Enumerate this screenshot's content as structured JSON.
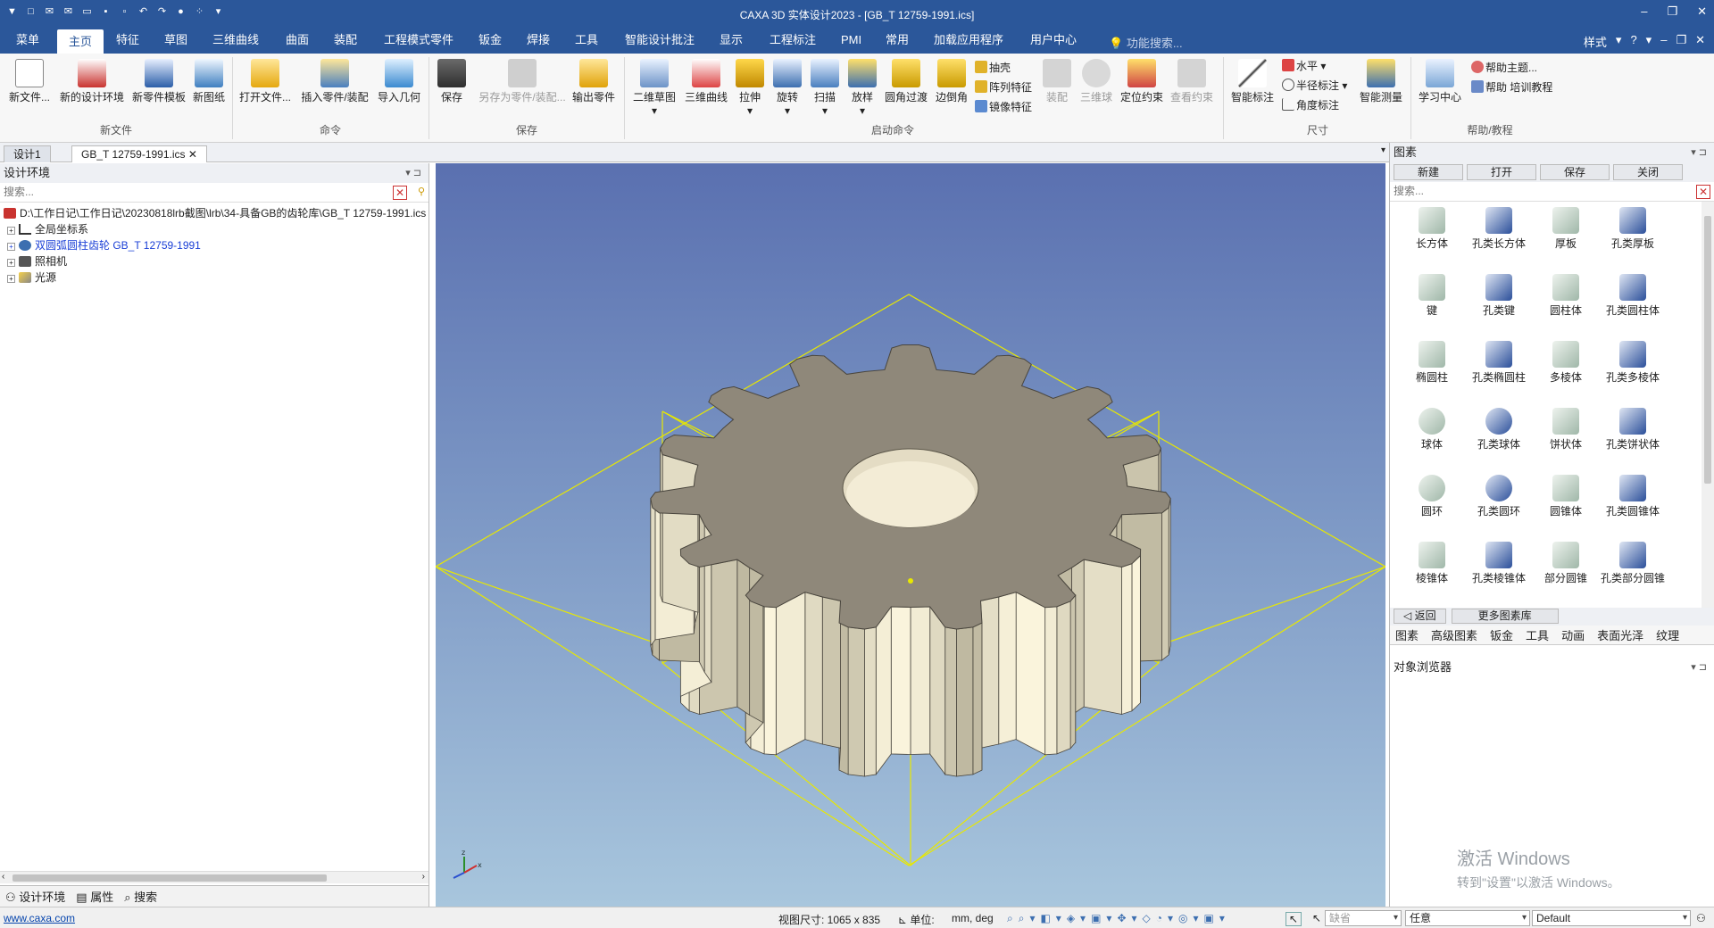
{
  "window": {
    "title": "CAXA 3D 实体设计2023 - [GB_T 12759-1991.ics]"
  },
  "menu": {
    "items": [
      "菜单",
      "主页",
      "特征",
      "草图",
      "三维曲线",
      "曲面",
      "装配",
      "工程模式零件",
      "钣金",
      "焊接",
      "工具",
      "智能设计批注",
      "显示",
      "工程标注",
      "PMI",
      "常用",
      "加载应用程序",
      "用户中心"
    ],
    "search_hint": "功能搜索...",
    "style_label": "样式"
  },
  "ribbon": {
    "new_file": "新文件...",
    "new_env": "新的设计环境",
    "new_template": "新零件模板",
    "new_drawing": "新图纸",
    "open_file": "打开文件...",
    "insert_part": "插入零件/装配",
    "import_geom": "导入几何",
    "save": "保存",
    "save_as": "另存为零件/装配...",
    "export_part": "输出零件",
    "sketch2d": "二维草图",
    "curve3d": "三维曲线",
    "extrude": "拉伸",
    "revolve": "旋转",
    "sweep": "扫描",
    "loft": "放样",
    "fillet": "圆角过渡",
    "chamfer": "边倒角",
    "shell": "抽壳",
    "pattern": "阵列特征",
    "mirror": "镜像特征",
    "assembly": "装配",
    "ball3d": "三维球",
    "constraint": "定位约束",
    "view_constraint": "查看约束",
    "smart_dim": "智能标注",
    "horizontal": "水平",
    "radius_dim": "半径标注",
    "angle_dim": "角度标注",
    "smart_measure": "智能测量",
    "learn_center": "学习中心",
    "help_topic": "帮助主题...",
    "help_training": "帮助 培训教程",
    "groups": [
      "新文件",
      "命令",
      "保存",
      "启动命令",
      "尺寸",
      "帮助/教程"
    ]
  },
  "doc_tabs": {
    "tab1": "设计1",
    "tab2": "GB_T 12759-1991.ics"
  },
  "left_panel": {
    "title": "设计环境",
    "search_placeholder": "搜索...",
    "tree": [
      "D:\\工作日记\\工作日记\\20230818lrb截图\\lrb\\34-具备GB的齿轮库\\GB_T 12759-1991.ics",
      "全局坐标系",
      "双圆弧圆柱齿轮 GB_T 12759-1991",
      "照相机",
      "光源"
    ],
    "tabs": [
      "设计环境",
      "属性",
      "搜索"
    ]
  },
  "right_panel": {
    "title": "图素",
    "new": "新建",
    "open": "打开",
    "save": "保存",
    "close": "关闭",
    "search_placeholder": "搜索...",
    "items": [
      "长方体",
      "孔类长方体",
      "厚板",
      "孔类厚板",
      "键",
      "孔类键",
      "圆柱体",
      "孔类圆柱体",
      "椭圆柱",
      "孔类椭圆柱",
      "多棱体",
      "孔类多棱体",
      "球体",
      "孔类球体",
      "饼状体",
      "孔类饼状体",
      "圆环",
      "孔类圆环",
      "圆锥体",
      "孔类圆锥体",
      "棱锥体",
      "孔类棱锥体",
      "部分圆锥",
      "孔类部分圆锥"
    ],
    "back": "返回",
    "more": "更多图素库",
    "tabs": [
      "图素",
      "高级图素",
      "钣金",
      "工具",
      "动画",
      "表面光泽",
      "纹理"
    ],
    "browser_title": "对象浏览器"
  },
  "status": {
    "link": "www.caxa.com",
    "view_size": "视图尺寸: 1065 x  835",
    "unit_label": "单位:",
    "unit_value": "mm, deg",
    "default1": "缺省",
    "any": "任意",
    "default2": "Default"
  },
  "watermark": {
    "line1": "激活 Windows",
    "line2": "转到\"设置\"以激活 Windows。"
  },
  "colors": {
    "chrome": "#2b579a",
    "gear": "#8f887a",
    "gear_side": "#e2dcc6",
    "bbox": "#e8e800"
  }
}
